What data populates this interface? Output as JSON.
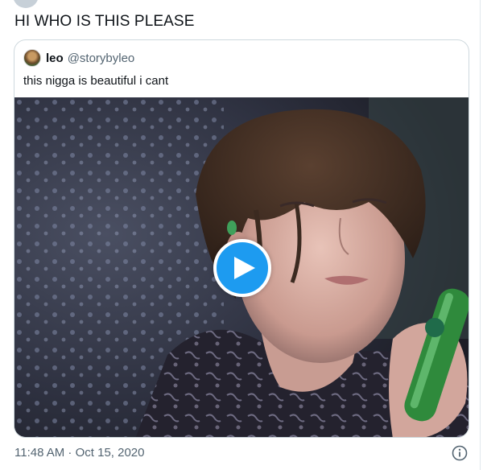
{
  "tweet": {
    "text": "HI WHO IS THIS PLEASE",
    "timestamp": "11:48 AM · Oct 15, 2020"
  },
  "quoted_tweet": {
    "name": "leo",
    "handle": "@storybyleo",
    "text": "this nigga is beautiful i cant",
    "media": {
      "type": "video",
      "play_icon": "play-icon"
    }
  },
  "icons": {
    "info": "info-icon"
  },
  "colors": {
    "accent": "#1d9bf0",
    "secondary_text": "#536471",
    "border": "#cfd9de"
  }
}
